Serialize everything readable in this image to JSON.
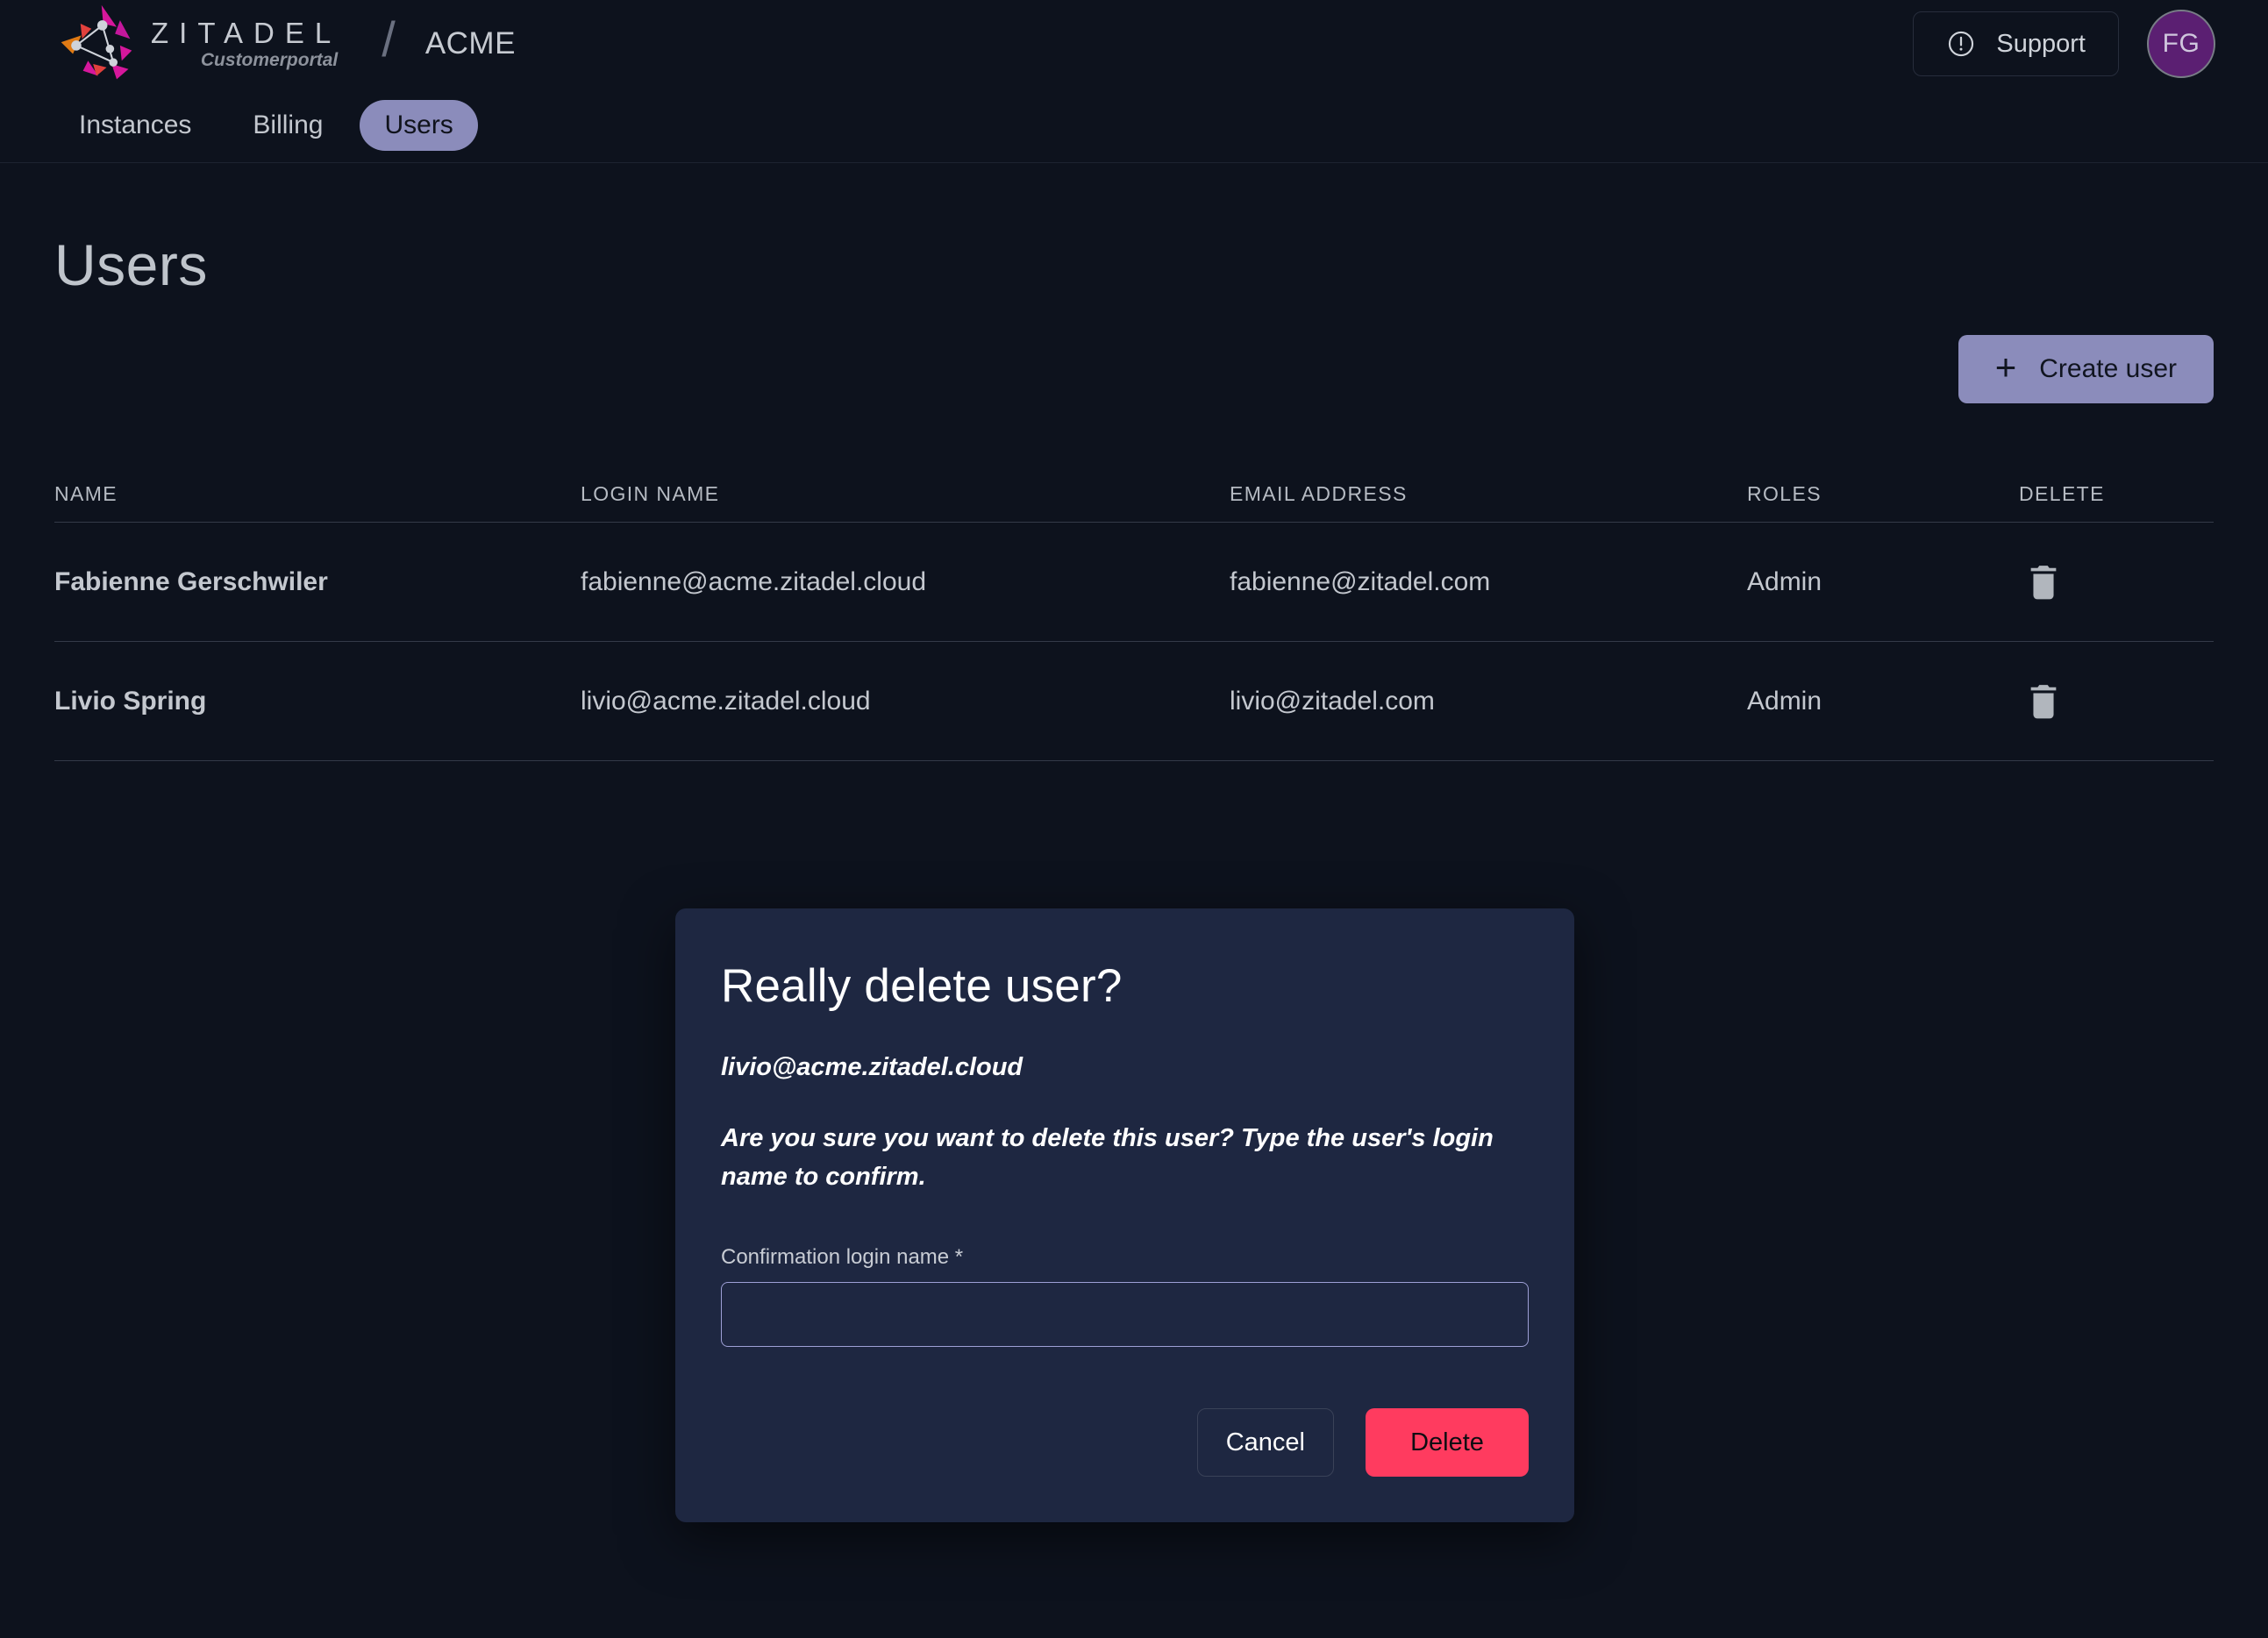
{
  "header": {
    "logo_text": "ZITADEL",
    "logo_subtitle": "Customerportal",
    "separator": "/",
    "org_name": "ACME",
    "support_label": "Support",
    "support_icon": "info-circle-icon",
    "avatar_initials": "FG",
    "avatar_color": "#5b1f72"
  },
  "tabs": [
    {
      "label": "Instances",
      "active": false
    },
    {
      "label": "Billing",
      "active": false
    },
    {
      "label": "Users",
      "active": true
    }
  ],
  "page": {
    "title": "Users",
    "create_button": {
      "label": "Create user",
      "icon": "plus-icon"
    }
  },
  "table": {
    "columns": [
      "NAME",
      "LOGIN NAME",
      "EMAIL ADDRESS",
      "ROLES",
      "DELETE"
    ],
    "rows": [
      {
        "name": "Fabienne Gerschwiler",
        "login_name": "fabienne@acme.zitadel.cloud",
        "email": "fabienne@zitadel.com",
        "roles": "Admin",
        "delete_icon": "trash-icon"
      },
      {
        "name": "Livio Spring",
        "login_name": "livio@acme.zitadel.cloud",
        "email": "livio@zitadel.com",
        "roles": "Admin",
        "delete_icon": "trash-icon"
      }
    ]
  },
  "dialog": {
    "title": "Really delete user?",
    "login_name": "livio@acme.zitadel.cloud",
    "description": "Are you sure you want to delete this user? Type the user's login name to confirm.",
    "field_label": "Confirmation login name *",
    "field_value": "",
    "field_placeholder": "",
    "cancel_label": "Cancel",
    "delete_label": "Delete",
    "delete_color": "#ff3b5f"
  },
  "colors": {
    "page_background": "#0d121d",
    "dialog_background": "#1e2741",
    "accent_purple": "#8b8cbb"
  }
}
